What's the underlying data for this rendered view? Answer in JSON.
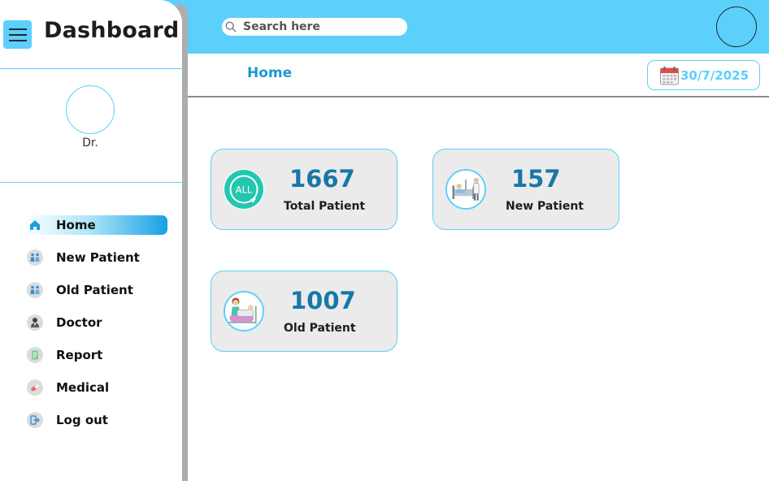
{
  "header": {
    "search_placeholder": "Search here",
    "accent_color": "#5ccffb"
  },
  "sidebar": {
    "brand": "Dashboard",
    "profile_name": "Dr.",
    "items": [
      {
        "label": "Home",
        "icon": "home-icon",
        "active": true
      },
      {
        "label": "New Patient",
        "icon": "patients-icon"
      },
      {
        "label": "Old Patient",
        "icon": "patients-icon"
      },
      {
        "label": "Doctor",
        "icon": "doctor-icon"
      },
      {
        "label": "Report",
        "icon": "report-icon"
      },
      {
        "label": "Medical",
        "icon": "medical-icon"
      },
      {
        "label": "Log out",
        "icon": "logout-icon"
      }
    ]
  },
  "subheader": {
    "breadcrumb": "Home",
    "date": "30/7/2025"
  },
  "cards": [
    {
      "value": "1667",
      "label": "Total Patient",
      "icon": "all-icon"
    },
    {
      "value": "157",
      "label": "New Patient",
      "icon": "hospital-bed-icon"
    },
    {
      "value": "1007",
      "label": "Old Patient",
      "icon": "patient-care-icon"
    }
  ]
}
